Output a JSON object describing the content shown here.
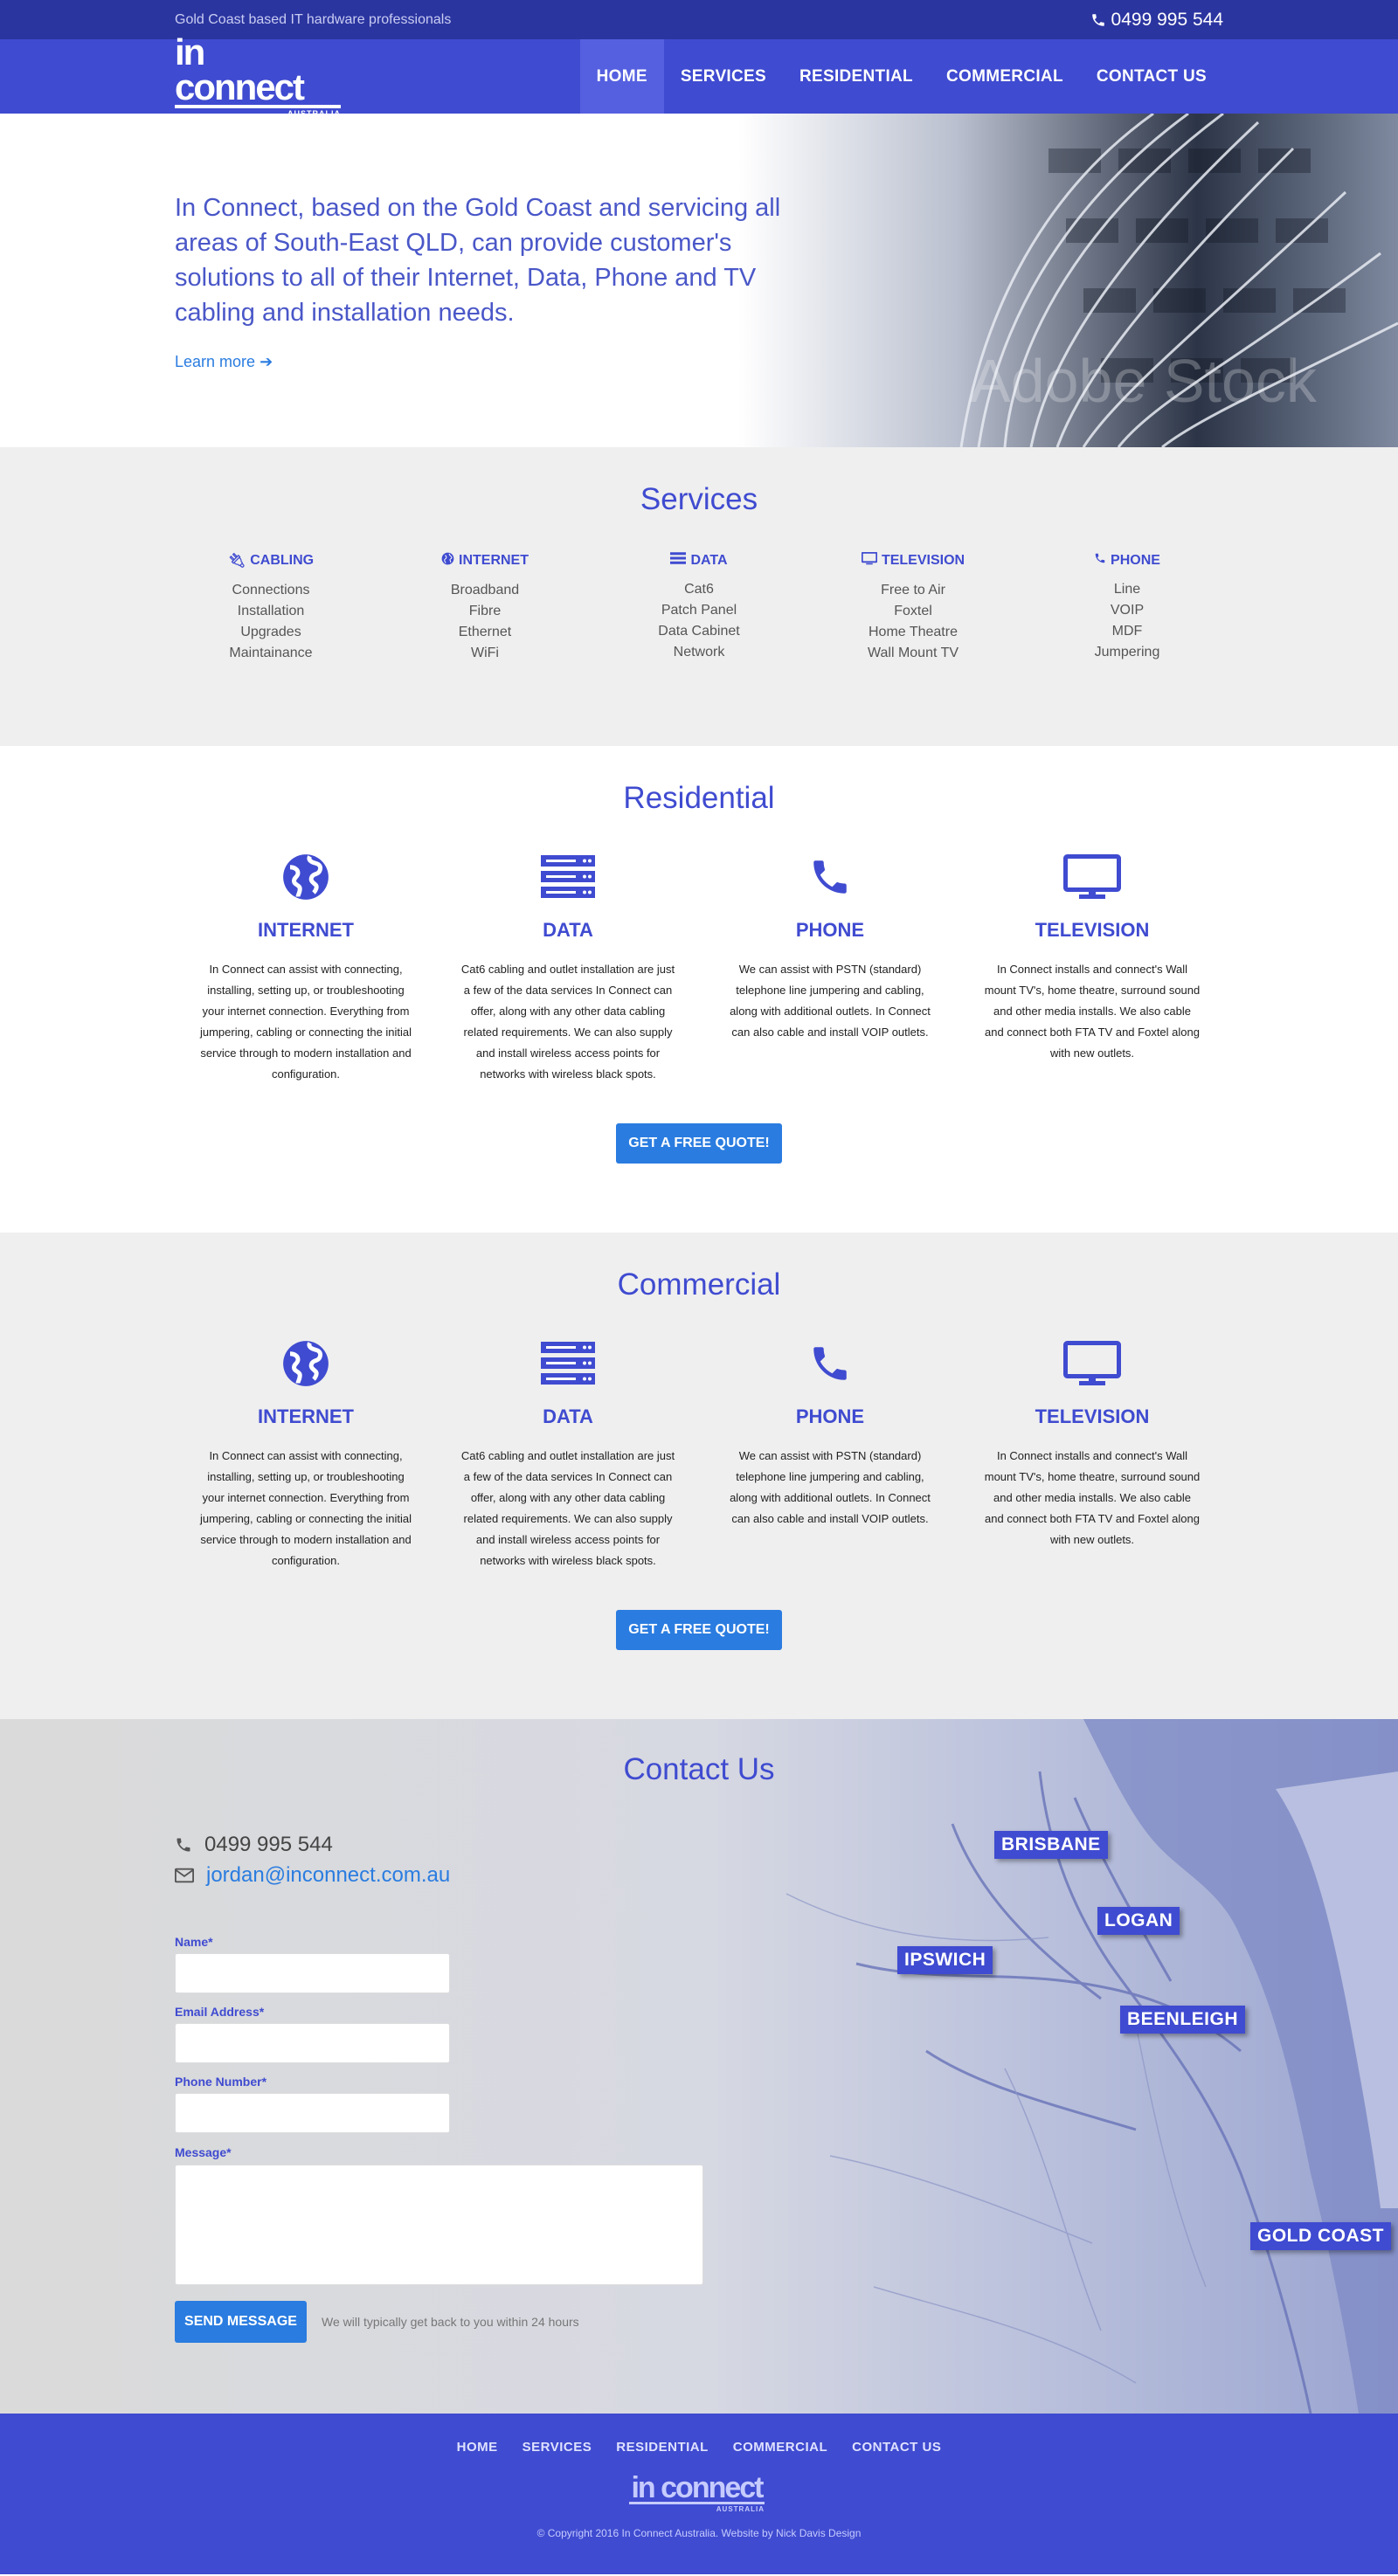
{
  "topbar": {
    "tagline": "Gold Coast based IT hardware professionals",
    "phone": "0499 995 544"
  },
  "logo": {
    "main": "in connect",
    "sub": "AUSTRALIA",
    "tm": "™"
  },
  "nav": {
    "items": [
      "HOME",
      "SERVICES",
      "RESIDENTIAL",
      "COMMERCIAL",
      "CONTACT US"
    ],
    "active": "HOME"
  },
  "hero": {
    "lead": "In Connect, based on the Gold Coast and servicing all areas of South-East QLD, can provide customer's solutions to all of their Internet, Data, Phone and TV cabling and installation needs.",
    "learn_more": "Learn more",
    "watermark": "Adobe Stock"
  },
  "services": {
    "title": "Services",
    "columns": [
      {
        "icon": "plug-icon",
        "title": "CABLING",
        "items": [
          "Connections",
          "Installation",
          "Upgrades",
          "Maintainance"
        ]
      },
      {
        "icon": "globe-icon",
        "title": "INTERNET",
        "items": [
          "Broadband",
          "Fibre",
          "Ethernet",
          "WiFi"
        ]
      },
      {
        "icon": "server-icon",
        "title": "DATA",
        "items": [
          "Cat6",
          "Patch Panel",
          "Data Cabinet",
          "Network"
        ]
      },
      {
        "icon": "monitor-icon",
        "title": "TELEVISION",
        "items": [
          "Free to Air",
          "Foxtel",
          "Home Theatre",
          "Wall Mount TV"
        ]
      },
      {
        "icon": "phone-icon",
        "title": "PHONE",
        "items": [
          "Line",
          "VOIP",
          "MDF",
          "Jumpering"
        ]
      }
    ]
  },
  "residential": {
    "title": "Residential",
    "features": [
      {
        "icon": "globe-icon",
        "title": "INTERNET",
        "text": "In Connect can assist with connecting, installing, setting up, or troubleshooting your internet connection. Everything from jumpering, cabling or connecting the initial service through to modern installation and configuration."
      },
      {
        "icon": "server-icon",
        "title": "DATA",
        "text": "Cat6 cabling and outlet installation are just a few of the data services In Connect can offer, along with any other data cabling related requirements. We can also supply and install wireless access points for networks with wireless black spots."
      },
      {
        "icon": "phone-icon",
        "title": "PHONE",
        "text": "We can assist with PSTN (standard) telephone line jumpering and cabling, along with additional outlets. In Connect can also cable and install VOIP outlets."
      },
      {
        "icon": "monitor-icon",
        "title": "TELEVISION",
        "text": "In Connect installs and connect's Wall mount TV's, home theatre, surround sound and other media installs. We also cable and connect both FTA TV and Foxtel along with new outlets."
      }
    ],
    "button": "GET A FREE QUOTE!"
  },
  "commercial": {
    "title": "Commercial",
    "features": [
      {
        "icon": "globe-icon",
        "title": "INTERNET",
        "text": "In Connect can assist with connecting, installing, setting up, or troubleshooting your internet connection. Everything from jumpering, cabling or connecting the initial service through to modern installation and configuration."
      },
      {
        "icon": "server-icon",
        "title": "DATA",
        "text": "Cat6 cabling and outlet installation are just a few of the data services In Connect can offer, along with any other data cabling related requirements. We can also supply and install wireless access points for networks with wireless black spots."
      },
      {
        "icon": "phone-icon",
        "title": "PHONE",
        "text": "We can assist with PSTN (standard) telephone line jumpering and cabling, along with additional outlets. In Connect can also cable and install VOIP outlets."
      },
      {
        "icon": "monitor-icon",
        "title": "TELEVISION",
        "text": "In Connect installs and connect's Wall mount TV's, home theatre, surround sound and other media installs. We also cable and connect both FTA TV and Foxtel along with new outlets."
      }
    ],
    "button": "GET A FREE QUOTE!"
  },
  "contact": {
    "title": "Contact Us",
    "phone": "0499 995 544",
    "email": "jordan@inconnect.com.au",
    "form": {
      "name_label": "Name*",
      "email_label": "Email Address*",
      "phone_label": "Phone Number*",
      "message_label": "Message*",
      "name_value": "",
      "email_value": "",
      "phone_value": "",
      "message_value": ""
    },
    "send_button": "SEND MESSAGE",
    "note": "We will typically get back to you within 24 hours",
    "map_cities": [
      "BRISBANE",
      "LOGAN",
      "IPSWICH",
      "BEENLEIGH",
      "GOLD COAST"
    ]
  },
  "footer": {
    "menu": [
      "HOME",
      "SERVICES",
      "RESIDENTIAL",
      "COMMERCIAL",
      "CONTACT US"
    ],
    "copyright": "© Copyright 2016 In Connect Australia. Website by Nick Davis Design"
  },
  "colors": {
    "primary": "#3f4bd0",
    "topbar": "#2b35a0",
    "accent": "#2a7ce0",
    "light_bg": "#efefef"
  }
}
